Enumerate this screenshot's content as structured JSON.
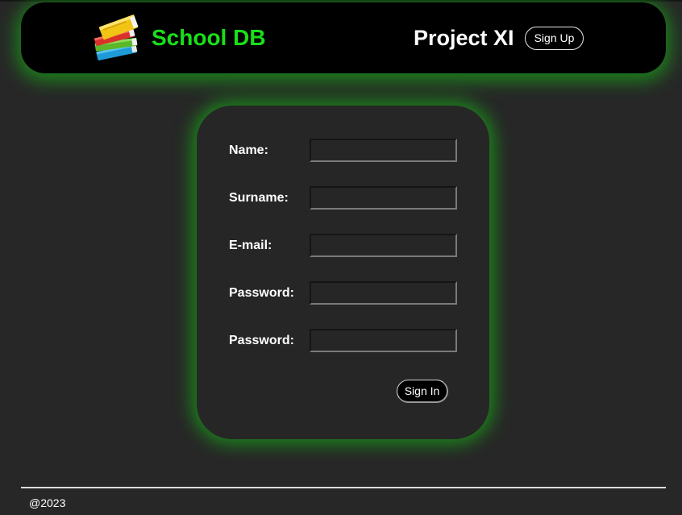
{
  "header": {
    "brand": "School DB",
    "project_title": "Project XI",
    "signup_label": "Sign Up",
    "logo_icon": "books-stack-icon"
  },
  "form": {
    "fields": [
      {
        "label": "Name:",
        "value": ""
      },
      {
        "label": "Surname:",
        "value": ""
      },
      {
        "label": "E-mail:",
        "value": ""
      },
      {
        "label": "Password:",
        "value": ""
      },
      {
        "label": "Password:",
        "value": ""
      }
    ],
    "signin_label": "Sign In"
  },
  "footer": {
    "copyright": "@2023"
  },
  "colors": {
    "accent": "#18e018",
    "background": "#272727",
    "header_bg": "#000000",
    "glow": "#14c814"
  }
}
